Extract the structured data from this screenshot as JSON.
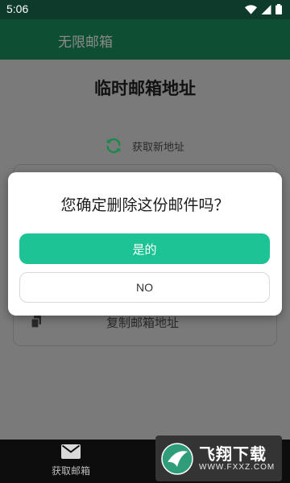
{
  "status_bar": {
    "time": "5:06"
  },
  "app_bar": {
    "title": "无限邮箱"
  },
  "main": {
    "title": "临时邮箱地址",
    "refresh_label": "获取新地址",
    "copy_label": "复制邮箱地址"
  },
  "bottom_nav": {
    "items": [
      {
        "label": "获取邮箱",
        "icon": "mail-icon"
      }
    ]
  },
  "dialog": {
    "message": "您确定删除这份邮件吗？",
    "confirm_label": "是的",
    "cancel_label": "NO"
  },
  "watermark": {
    "main": "飞翔下载",
    "url": "WWW.FXXZ.COM"
  },
  "colors": {
    "accent": "#1dc394",
    "app_bar": "#0e4f33",
    "status_bar": "#0d3a2a",
    "refresh_icon": "#1a8a4a"
  }
}
